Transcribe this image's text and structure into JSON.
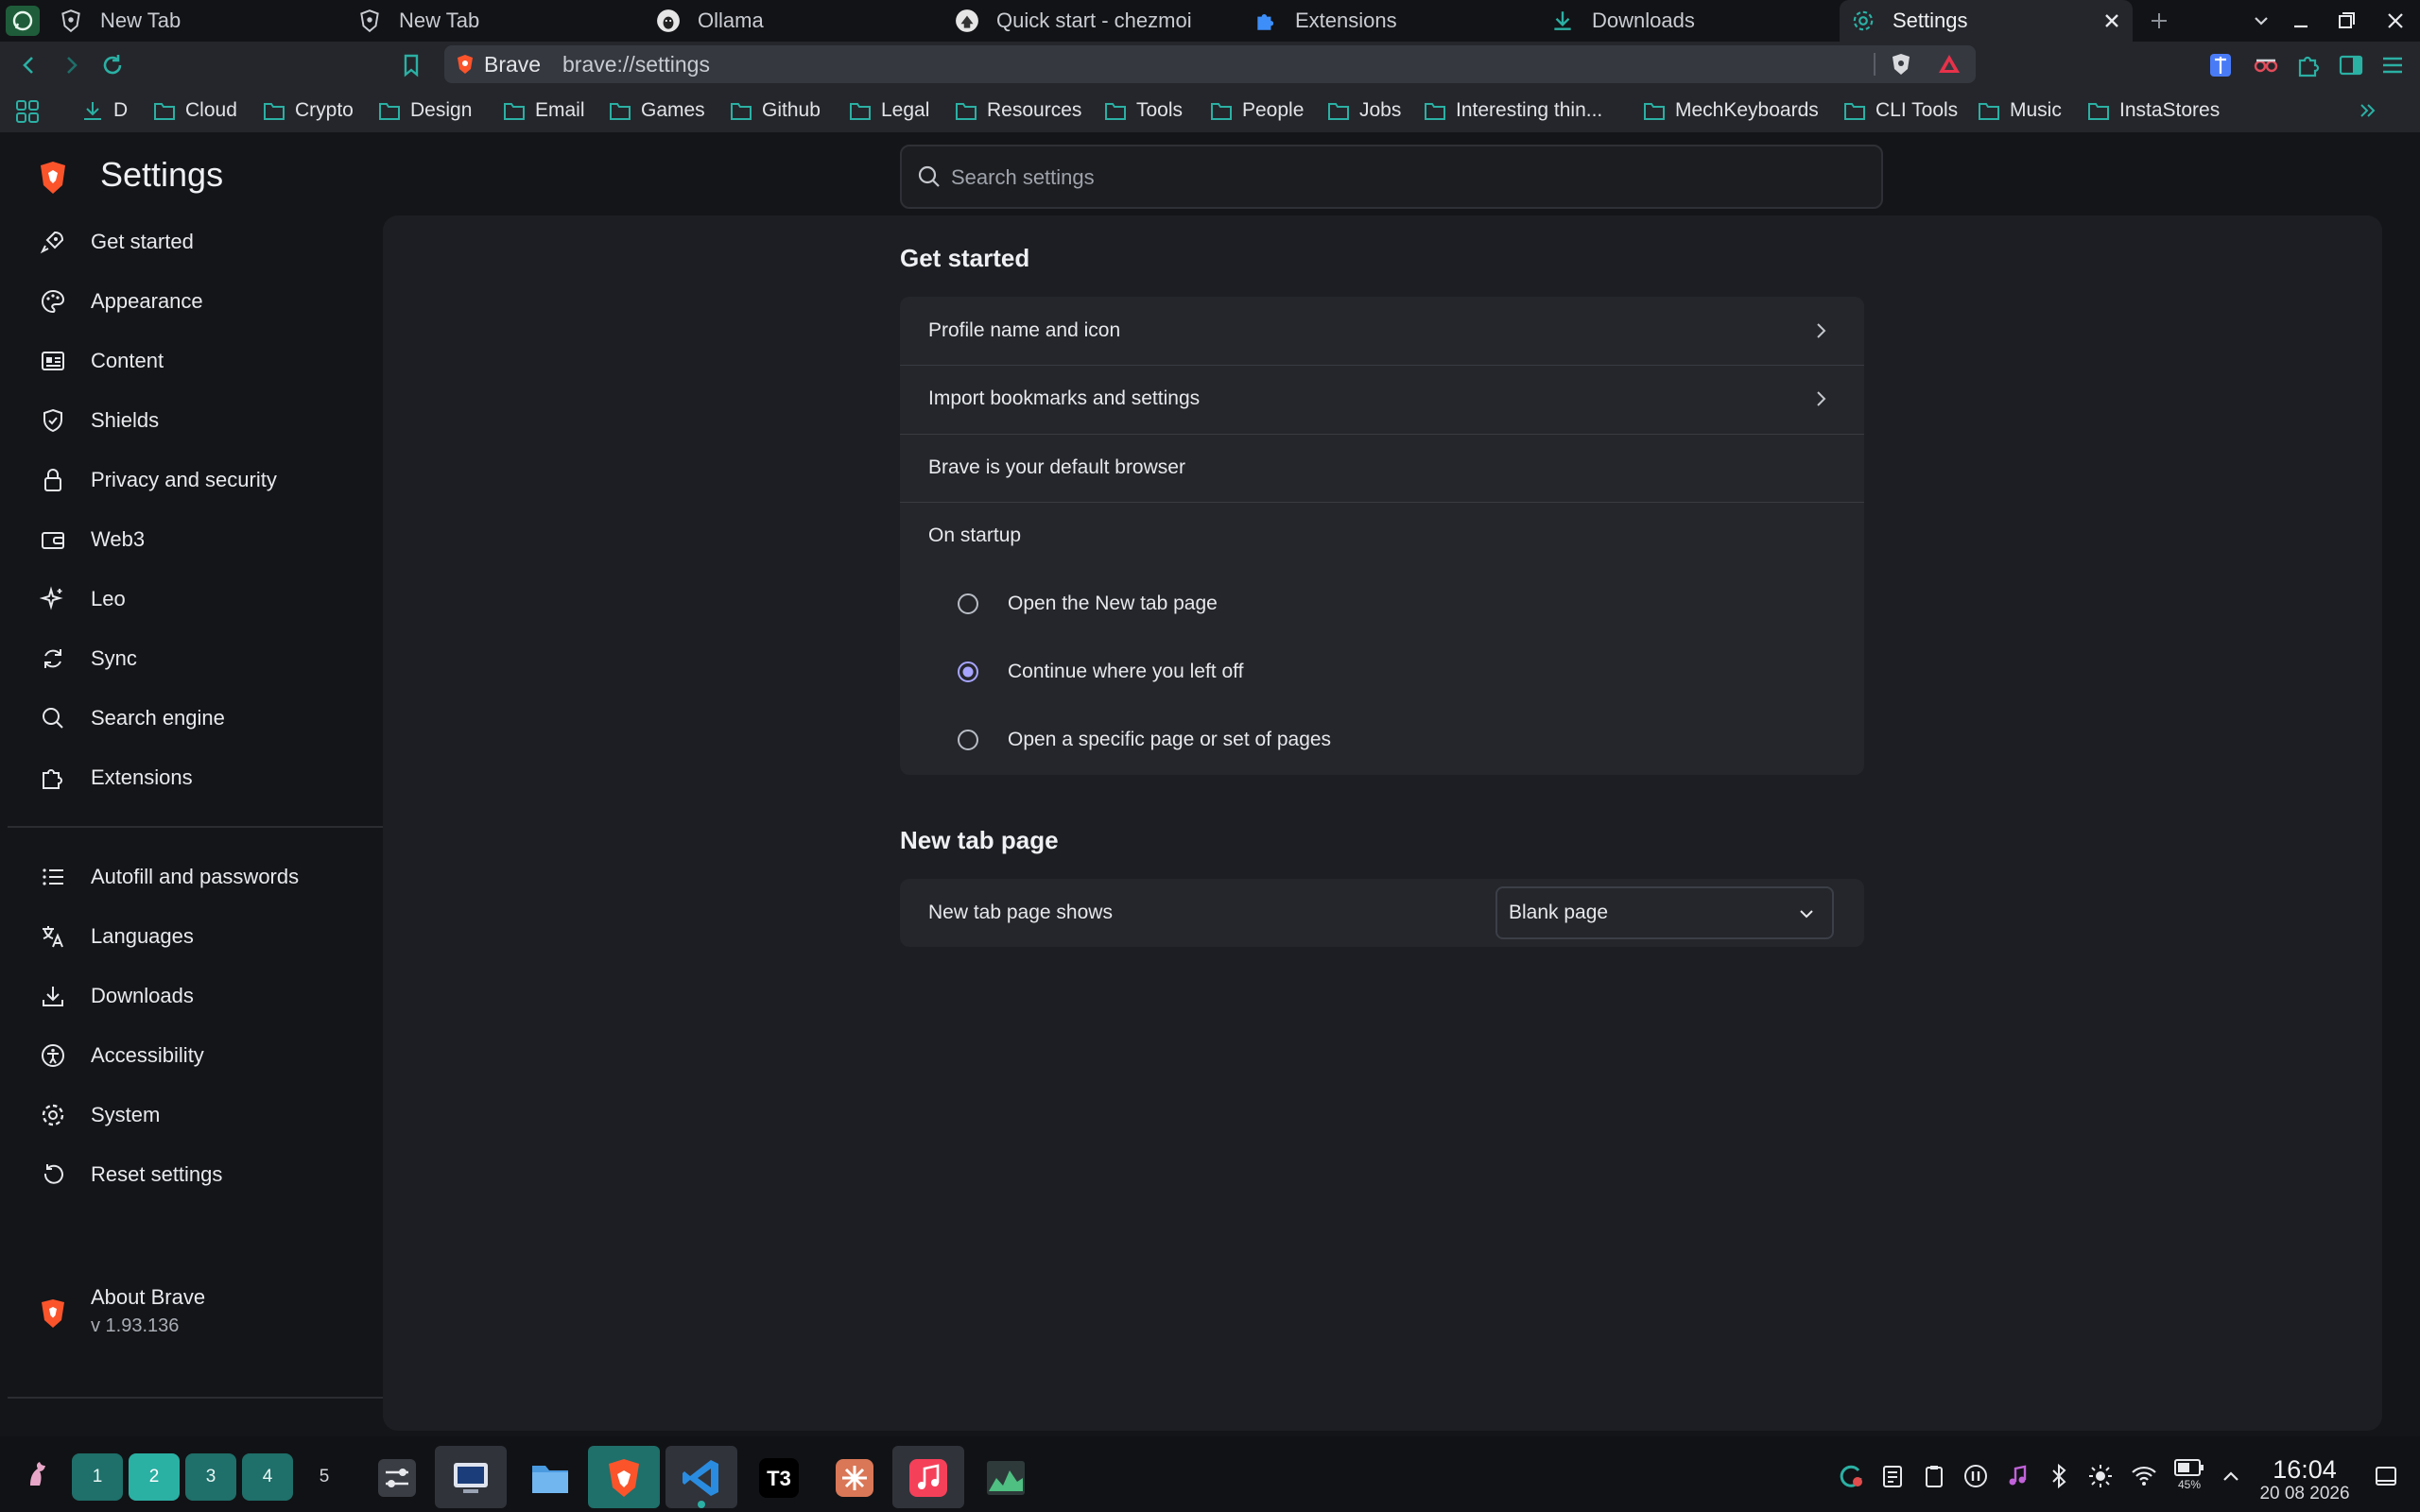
{
  "tabs": [
    {
      "title": "New Tab",
      "icon": "brave-shield-icon"
    },
    {
      "title": "New Tab",
      "icon": "brave-shield-icon"
    },
    {
      "title": "Ollama",
      "icon": "ollama-icon"
    },
    {
      "title": "Quick start - chezmoi",
      "icon": "chezmoi-icon"
    },
    {
      "title": "Extensions",
      "icon": "puzzle-icon"
    },
    {
      "title": "Downloads",
      "icon": "download-icon"
    },
    {
      "title": "Settings",
      "icon": "gear-icon",
      "active": true
    }
  ],
  "address_bar": {
    "site_name": "Brave",
    "url": "brave://settings"
  },
  "bookmarks": [
    "D",
    "Cloud",
    "Crypto",
    "Design",
    "Email",
    "Games",
    "Github",
    "Legal",
    "Resources",
    "Tools",
    "People",
    "Jobs",
    "Interesting thin...",
    "MechKeyboards",
    "CLI Tools",
    "Music",
    "InstaStores"
  ],
  "header": {
    "title": "Settings",
    "search_placeholder": "Search settings"
  },
  "sidebar": {
    "items": [
      {
        "label": "Get started",
        "icon": "rocket-icon"
      },
      {
        "label": "Appearance",
        "icon": "palette-icon"
      },
      {
        "label": "Content",
        "icon": "content-icon"
      },
      {
        "label": "Shields",
        "icon": "shield-icon"
      },
      {
        "label": "Privacy and security",
        "icon": "lock-icon"
      },
      {
        "label": "Web3",
        "icon": "wallet-icon"
      },
      {
        "label": "Leo",
        "icon": "sparkle-icon"
      },
      {
        "label": "Sync",
        "icon": "sync-icon"
      },
      {
        "label": "Search engine",
        "icon": "search-icon"
      },
      {
        "label": "Extensions",
        "icon": "puzzle-icon"
      }
    ],
    "items2": [
      {
        "label": "Autofill and passwords",
        "icon": "list-icon"
      },
      {
        "label": "Languages",
        "icon": "translate-icon"
      },
      {
        "label": "Downloads",
        "icon": "download-icon"
      },
      {
        "label": "Accessibility",
        "icon": "accessibility-icon"
      },
      {
        "label": "System",
        "icon": "gear-icon"
      },
      {
        "label": "Reset settings",
        "icon": "reset-icon"
      }
    ],
    "about": {
      "label": "About Brave",
      "version": "v 1.93.136"
    }
  },
  "get_started": {
    "title": "Get started",
    "profile": "Profile name and icon",
    "import": "Import bookmarks and settings",
    "default_browser": "Brave is your default browser",
    "on_startup": "On startup",
    "options": [
      "Open the New tab page",
      "Continue where you left off",
      "Open a specific page or set of pages"
    ],
    "selected_option": 1
  },
  "new_tab_page": {
    "title": "New tab page",
    "row_label": "New tab page shows",
    "selected": "Blank page"
  },
  "taskbar": {
    "workspaces": [
      "1",
      "2",
      "3",
      "4",
      "5"
    ],
    "active_workspace": "2",
    "apps": [
      "settings-icon",
      "display-icon",
      "file-manager-icon",
      "brave-icon",
      "vscode-icon",
      "t3-icon",
      "claude-icon",
      "music-icon",
      "monitor-icon"
    ],
    "t3_label": "T3",
    "battery": "45%",
    "time": "16:04",
    "date": "20 08 2026"
  },
  "colors": {
    "accent": "#2bb0a4",
    "brave_orange": "#fb542b",
    "radio_selected": "#a7a4ff"
  }
}
